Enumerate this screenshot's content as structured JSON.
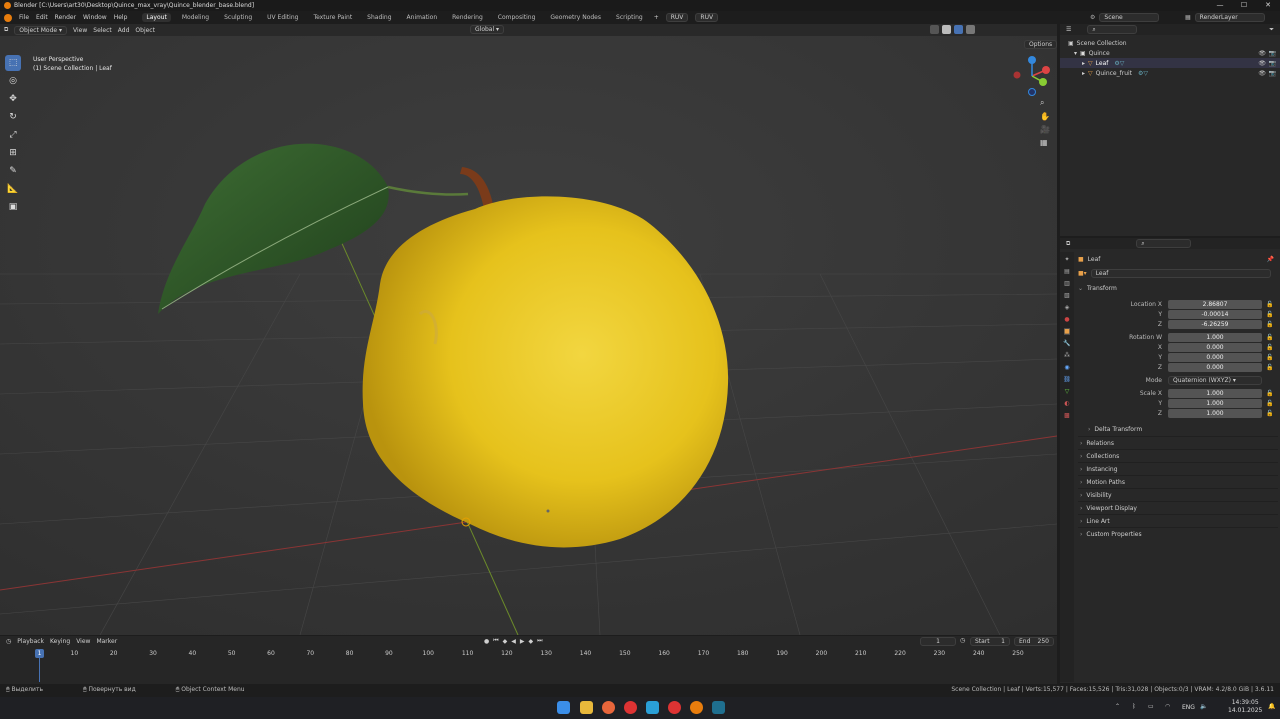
{
  "window": {
    "title": "Blender [C:\\Users\\art30\\Desktop\\Quince_max_vray\\Quince_blender_base.blend]"
  },
  "menubar": {
    "menus": [
      "File",
      "Edit",
      "Render",
      "Window",
      "Help"
    ],
    "workspaces": [
      "Layout",
      "Modeling",
      "Sculpting",
      "UV Editing",
      "Texture Paint",
      "Shading",
      "Animation",
      "Rendering",
      "Compositing",
      "Geometry Nodes",
      "Scripting"
    ],
    "active_workspace": "Layout",
    "plus": "+",
    "ruv1": "RUV",
    "ruv2": "RUV",
    "scene_label": "Scene",
    "viewlayer_label": "RenderLayer"
  },
  "viewport": {
    "mode": "Object Mode",
    "menus": [
      "View",
      "Select",
      "Add",
      "Object"
    ],
    "transform": "Global",
    "options": "Options",
    "perspective": "User Perspective",
    "collection": "(1) Scene Collection | Leaf",
    "gizmo": {
      "x": "X",
      "y": "Y",
      "z": "Z"
    }
  },
  "outliner": {
    "root": "Scene Collection",
    "items": [
      {
        "label": "Quince",
        "level": 1
      },
      {
        "label": "Leaf",
        "level": 2
      },
      {
        "label": "Quince_fruit",
        "level": 2
      }
    ]
  },
  "properties": {
    "object_name": "Leaf",
    "datablock": "Leaf",
    "transform_title": "Transform",
    "location": {
      "label": "Location X",
      "x": "2.86807",
      "y_label": "Y",
      "y": "-0.00014",
      "z_label": "Z",
      "z": "-6.26259"
    },
    "rotation": {
      "label": "Rotation W",
      "w": "1.000",
      "x_label": "X",
      "x": "0.000",
      "y_label": "Y",
      "y": "0.000",
      "z_label": "Z",
      "z": "0.000"
    },
    "mode_label": "Mode",
    "mode_value": "Quaternion (WXYZ)",
    "scale": {
      "label": "Scale X",
      "x": "1.000",
      "y_label": "Y",
      "y": "1.000",
      "z_label": "Z",
      "z": "1.000"
    },
    "delta_transform": "Delta Transform",
    "sections": [
      "Relations",
      "Collections",
      "Instancing",
      "Motion Paths",
      "Visibility",
      "Viewport Display",
      "Line Art",
      "Custom Properties"
    ]
  },
  "timeline": {
    "menus": [
      "Playback",
      "Keying",
      "View",
      "Marker"
    ],
    "current_frame": "1",
    "start_label": "Start",
    "start": "1",
    "end_label": "End",
    "end": "250",
    "ticks": [
      "10",
      "20",
      "30",
      "40",
      "50",
      "60",
      "70",
      "80",
      "90",
      "100",
      "110",
      "120",
      "130",
      "140",
      "150",
      "160",
      "170",
      "180",
      "190",
      "200",
      "210",
      "220",
      "230",
      "240",
      "250"
    ],
    "cursor_frame": "1"
  },
  "statusbar": {
    "hint1": "Выделить",
    "hint2": "Повернуть вид",
    "hint3": "Object Context Menu",
    "stats": "Scene Collection | Leaf | Verts:15,577 | Faces:15,526 | Tris:31,028 | Objects:0/3 | VRAM: 4.2/8.0 GiB | 3.6.11"
  },
  "taskbar": {
    "lang": "ENG",
    "time": "14:39:05",
    "date": "14.01.2025"
  },
  "colors": {
    "accent": "#4772b3",
    "fruit": "#e8c21a",
    "leaf": "#2f5a26",
    "stem": "#7a3b1a",
    "x_axis": "#a33b3b",
    "y_axis": "#6e8a2a"
  }
}
